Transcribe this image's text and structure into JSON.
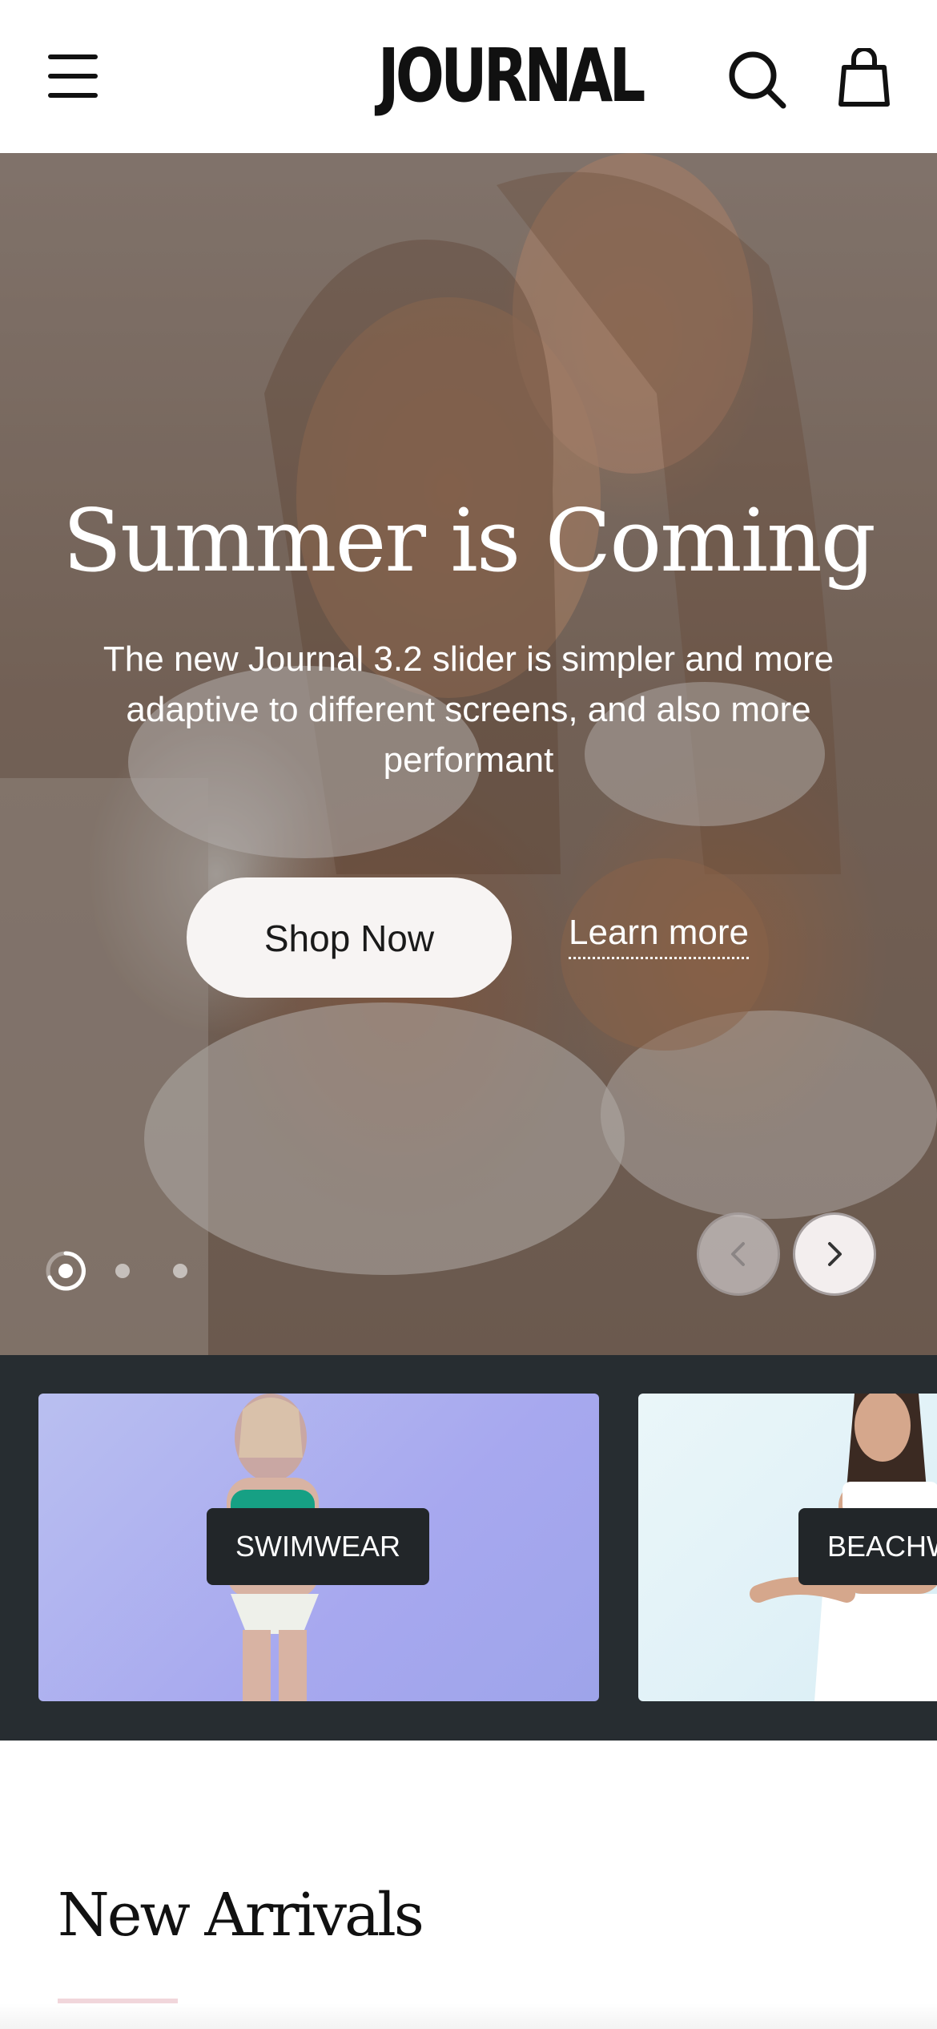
{
  "header": {
    "logo_text": "JOURNAL",
    "menu_icon": "hamburger-menu-icon",
    "search_icon": "search-icon",
    "cart_icon": "shopping-bag-icon"
  },
  "hero": {
    "title": "Summer is Coming",
    "subtitle": "The new Journal 3.2 slider is simpler and more adaptive to different screens, and also more performant",
    "primary_button": "Shop Now",
    "secondary_link": "Learn more",
    "slide_count": 3,
    "active_slide": 1,
    "prev_icon": "chevron-left-icon",
    "next_icon": "chevron-right-icon"
  },
  "categories": [
    {
      "label": "SWIMWEAR"
    },
    {
      "label": "BEACHW"
    }
  ],
  "new_arrivals": {
    "title": "New Arrivals"
  },
  "colors": {
    "category_strip_bg": "#272d31",
    "button_bg": "#f7f4f3",
    "underline_accent": "#f1d6db"
  }
}
